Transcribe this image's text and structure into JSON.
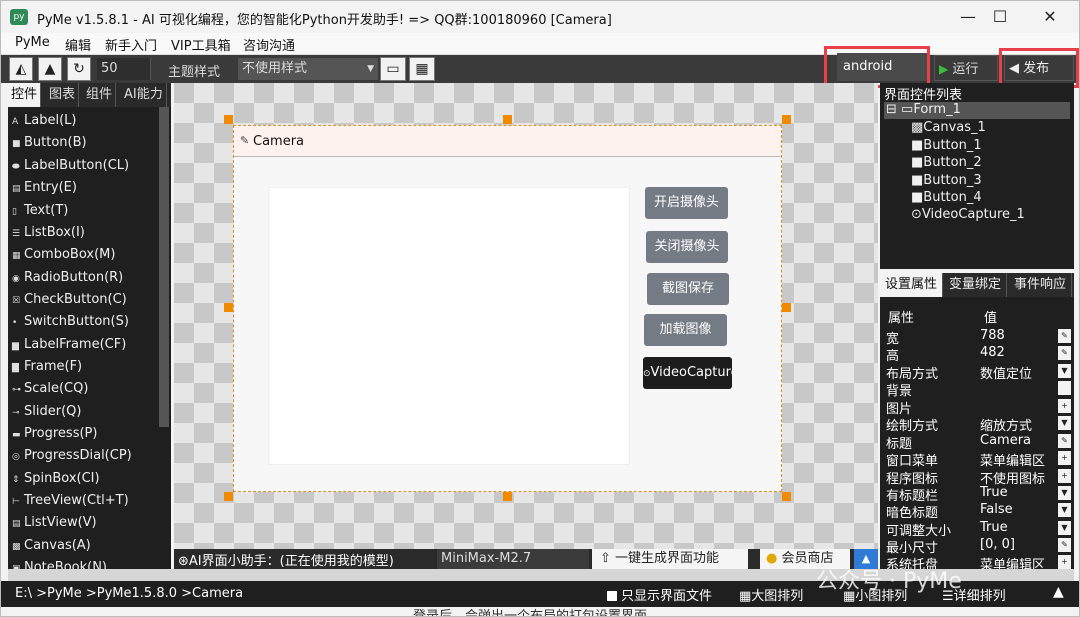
{
  "window": {
    "title": "PyMe v1.5.8.1 - AI 可视化编程，您的智能化Python开发助手!  => QQ群:100180960    [Camera]",
    "minimize": "—",
    "maximize": "☐",
    "close": "✕"
  },
  "menu": [
    "PyMe",
    "编辑",
    "新手入门",
    "VIP工具箱",
    "咨询沟通"
  ],
  "toolbar": {
    "zoom": "50",
    "theme_label": "主题样式",
    "theme_value": "不使用样式",
    "platform": "android",
    "run_label": "运行",
    "publish_label": "发布"
  },
  "left_tabs": [
    "控件",
    "图表",
    "组件",
    "AI能力"
  ],
  "widgets": [
    "Label(L)",
    "Button(B)",
    "LabelButton(CL)",
    "Entry(E)",
    "Text(T)",
    "ListBox(I)",
    "ComboBox(M)",
    "RadioButton(R)",
    "CheckButton(C)",
    "SwitchButton(S)",
    "LabelFrame(CF)",
    "Frame(F)",
    "Scale(CQ)",
    "Slider(Q)",
    "Progress(P)",
    "ProgressDial(CP)",
    "SpinBox(CI)",
    "TreeView(Ctl+T)",
    "ListView(V)",
    "Canvas(A)",
    "NoteBook(N)"
  ],
  "form": {
    "title": "Camera",
    "buttons": [
      "开启摄像头",
      "关闭摄像头",
      "截图保存",
      "加载图像"
    ],
    "video_capture": "VideoCapture"
  },
  "ai_bar": {
    "label": "AI界面小助手：(正在使用我的模型)",
    "model": "MiniMax-M2.7",
    "generate": "一键生成界面功能",
    "shop": "会员商店"
  },
  "tree": {
    "header": "界面控件列表",
    "items": [
      "Form_1",
      "Canvas_1",
      "Button_1",
      "Button_2",
      "Button_3",
      "Button_4",
      "VideoCapture_1"
    ]
  },
  "prop_tabs": [
    "设置属性",
    "变量绑定",
    "事件响应"
  ],
  "props": {
    "header_key": "属性",
    "header_val": "值",
    "rows": [
      {
        "key": "宽",
        "val": "788"
      },
      {
        "key": "高",
        "val": "482"
      },
      {
        "key": "布局方式",
        "val": "数值定位"
      },
      {
        "key": "背景",
        "val": ""
      },
      {
        "key": "图片",
        "val": ""
      },
      {
        "key": "绘制方式",
        "val": "缩放方式"
      },
      {
        "key": "标题",
        "val": "Camera"
      },
      {
        "key": "窗口菜单",
        "val": "菜单编辑区"
      },
      {
        "key": "程序图标",
        "val": "不使用图标"
      },
      {
        "key": "有标题栏",
        "val": "True"
      },
      {
        "key": "暗色标题",
        "val": "False"
      },
      {
        "key": "可调整大小",
        "val": "True"
      },
      {
        "key": "最小尺寸",
        "val": "[0, 0]"
      },
      {
        "key": "系统托盘",
        "val": "菜单编辑区"
      }
    ]
  },
  "status": {
    "path": "E:\\ >PyMe >PyMe1.5.8.0 >Camera",
    "only_ui": "只显示界面文件",
    "large": "大图排列",
    "small": "小图排列",
    "detail": "详细排列"
  },
  "watermark": "公众号 · PyMe",
  "footer": "登录后，会弹出一个布局的打包设置界面"
}
